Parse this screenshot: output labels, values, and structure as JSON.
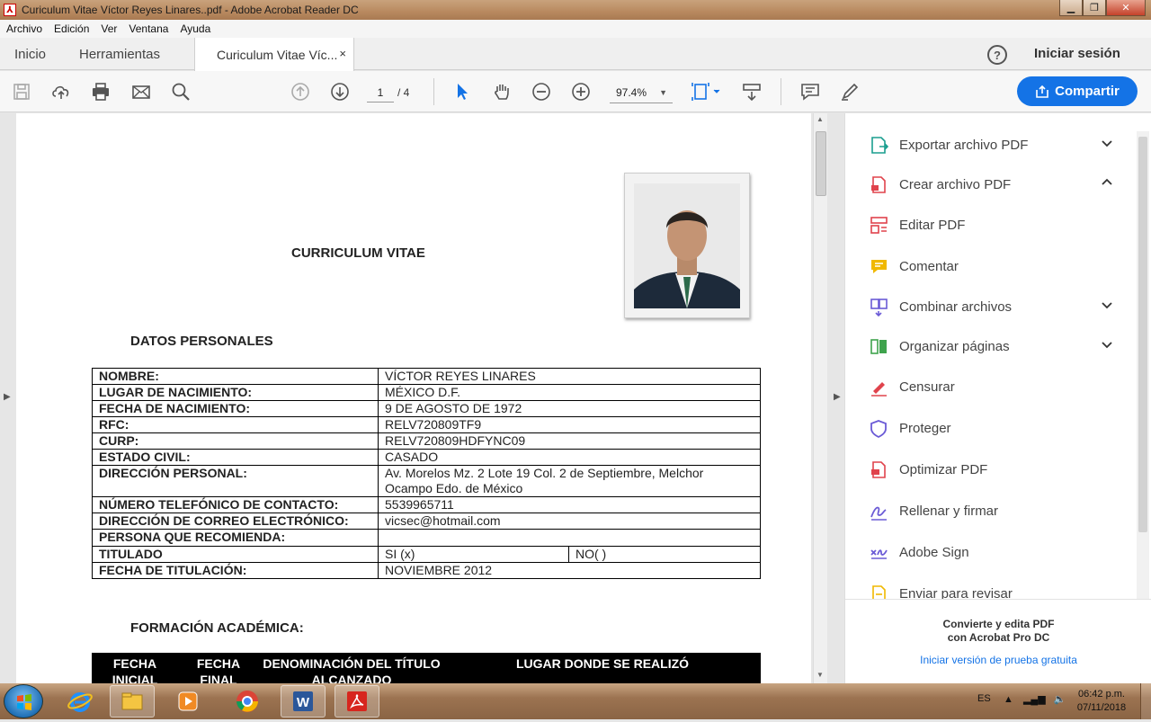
{
  "window": {
    "title": "Curiculum Vitae Víctor Reyes Linares..pdf - Adobe Acrobat Reader DC"
  },
  "menu": [
    "Archivo",
    "Edición",
    "Ver",
    "Ventana",
    "Ayuda"
  ],
  "tabs": {
    "home": "Inicio",
    "tools": "Herramientas",
    "document": "Curiculum Vitae Víc...",
    "close_glyph": "×"
  },
  "header": {
    "help_glyph": "?",
    "signin": "Iniciar sesión"
  },
  "toolbar": {
    "page_current": "1",
    "page_total": "/ 4",
    "zoom": "97.4%",
    "share_label": "Compartir"
  },
  "document": {
    "title": "CURRICULUM VITAE",
    "section_personal": "DATOS PERSONALES",
    "personal_rows": [
      {
        "label": "NOMBRE:",
        "value": "VÍCTOR REYES LINARES"
      },
      {
        "label": "LUGAR DE NACIMIENTO:",
        "value": "MÉXICO D.F."
      },
      {
        "label": "FECHA DE NACIMIENTO:",
        "value": "9 DE AGOSTO DE 1972"
      },
      {
        "label": "RFC:",
        "value": "RELV720809TF9"
      },
      {
        "label": "CURP:",
        "value": "RELV720809HDFYNC09"
      },
      {
        "label": "ESTADO CIVIL:",
        "value": "CASADO"
      },
      {
        "label": "DIRECCIÓN PERSONAL:",
        "value": "Av. Morelos Mz. 2 Lote 19 Col. 2 de Septiembre, Melchor Ocampo Edo. de México"
      },
      {
        "label": "NÚMERO TELEFÓNICO DE CONTACTO:",
        "value": "5539965711"
      },
      {
        "label": "DIRECCIÓN DE CORREO ELECTRÓNICO:",
        "value": "vicsec@hotmail.com"
      },
      {
        "label": "PERSONA QUE RECOMIENDA:",
        "value": ""
      }
    ],
    "titulado": {
      "label": "TITULADO",
      "si": "SI (x)",
      "no": "NO(    )"
    },
    "fecha_titulacion": {
      "label": "FECHA DE TITULACIÓN:",
      "value": "NOVIEMBRE 2012"
    },
    "section_academic": "FORMACIÓN ACADÉMICA:",
    "academic_headers": [
      "FECHA INICIAL",
      "FECHA FINAL",
      "DENOMINACIÓN DEL TÍTULO ALCANZADO",
      "LUGAR DONDE SE REALIZÓ"
    ]
  },
  "tools_panel": {
    "items": [
      {
        "label": "Exportar archivo PDF",
        "icon": "export-pdf-icon",
        "color": "#1a9e8f",
        "chevron": "down"
      },
      {
        "label": "Crear archivo PDF",
        "icon": "create-pdf-icon",
        "color": "#e0434c",
        "chevron": "up"
      },
      {
        "label": "Editar PDF",
        "icon": "edit-pdf-icon",
        "color": "#e0434c",
        "chevron": ""
      },
      {
        "label": "Comentar",
        "icon": "comment-icon",
        "color": "#f0b800",
        "chevron": ""
      },
      {
        "label": "Combinar archivos",
        "icon": "combine-icon",
        "color": "#6b5bd6",
        "chevron": "down"
      },
      {
        "label": "Organizar páginas",
        "icon": "organize-icon",
        "color": "#3fa34d",
        "chevron": "down"
      },
      {
        "label": "Censurar",
        "icon": "redact-icon",
        "color": "#e0434c",
        "chevron": ""
      },
      {
        "label": "Proteger",
        "icon": "protect-icon",
        "color": "#6b5bd6",
        "chevron": ""
      },
      {
        "label": "Optimizar PDF",
        "icon": "optimize-icon",
        "color": "#e0434c",
        "chevron": ""
      },
      {
        "label": "Rellenar y firmar",
        "icon": "fill-sign-icon",
        "color": "#6b5bd6",
        "chevron": ""
      },
      {
        "label": "Adobe Sign",
        "icon": "adobe-sign-icon",
        "color": "#6b5bd6",
        "chevron": ""
      },
      {
        "label": "Enviar para revisar",
        "icon": "send-review-icon",
        "color": "#f0b800",
        "chevron": ""
      }
    ],
    "promo_line1": "Convierte y edita PDF",
    "promo_line2": "con Acrobat Pro DC",
    "promo_link": "Iniciar versión de prueba gratuita"
  },
  "taskbar": {
    "lang": "ES",
    "time": "06:42 p.m.",
    "date": "07/11/2018"
  },
  "colors": {
    "accent": "#1473e6",
    "titlebar": "#b8895f"
  }
}
